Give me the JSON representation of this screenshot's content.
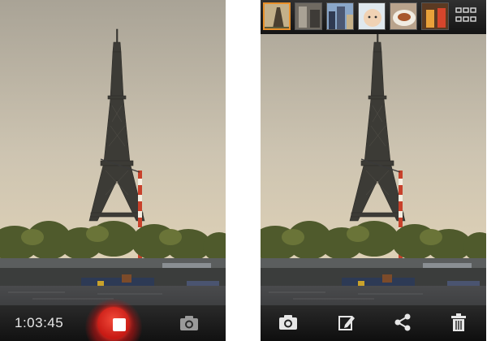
{
  "left_screen": {
    "recording_timer": "1:03:45",
    "icons": {
      "record": "stop-record-icon",
      "camera": "camera-icon"
    },
    "accent_color": "#d7261c"
  },
  "right_screen": {
    "thumbnails": [
      {
        "name": "eiffel-tower-thumbnail",
        "selected": true
      },
      {
        "name": "street-thumbnail",
        "selected": false
      },
      {
        "name": "city-thumbnail",
        "selected": false
      },
      {
        "name": "baby-thumbnail",
        "selected": false
      },
      {
        "name": "food-thumbnail",
        "selected": false
      },
      {
        "name": "drinks-thumbnail",
        "selected": false
      }
    ],
    "icons": {
      "grid": "grid-view-icon",
      "camera": "camera-icon",
      "edit": "edit-icon",
      "share": "share-icon",
      "delete": "trash-icon"
    },
    "selection_color": "#e8902a"
  }
}
